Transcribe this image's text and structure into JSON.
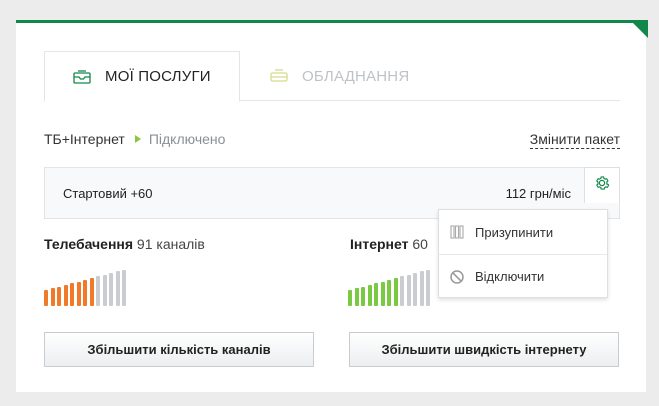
{
  "tabs": [
    {
      "label": "МОЇ ПОСЛУГИ",
      "active": true,
      "icon": "envelope-icon"
    },
    {
      "label": "ОБЛАДНАННЯ",
      "active": false,
      "icon": "router-icon"
    }
  ],
  "breadcrumb": {
    "package": "ТБ+Інтернет",
    "status": "Підключено"
  },
  "change_package": "Змінити пакет",
  "plan": {
    "name": "Стартовий +60",
    "price": "112 грн/міс"
  },
  "menu": {
    "items": [
      {
        "label": "Призупинити",
        "icon": "pause-icon"
      },
      {
        "label": "Відключити",
        "icon": "block-icon"
      }
    ]
  },
  "tv": {
    "title": "Телебачення",
    "count": "91 каналів",
    "level": 0.62,
    "button": "Збільшити кількість каналів"
  },
  "internet": {
    "title": "Інтернет",
    "speed": "60",
    "level": 0.62,
    "button": "Збільшити швидкість інтернету"
  },
  "colors": {
    "accent": "#12874a",
    "tv_active": "#f07a2a",
    "net_active": "#7ac943",
    "inactive": "#c9cdd1"
  }
}
